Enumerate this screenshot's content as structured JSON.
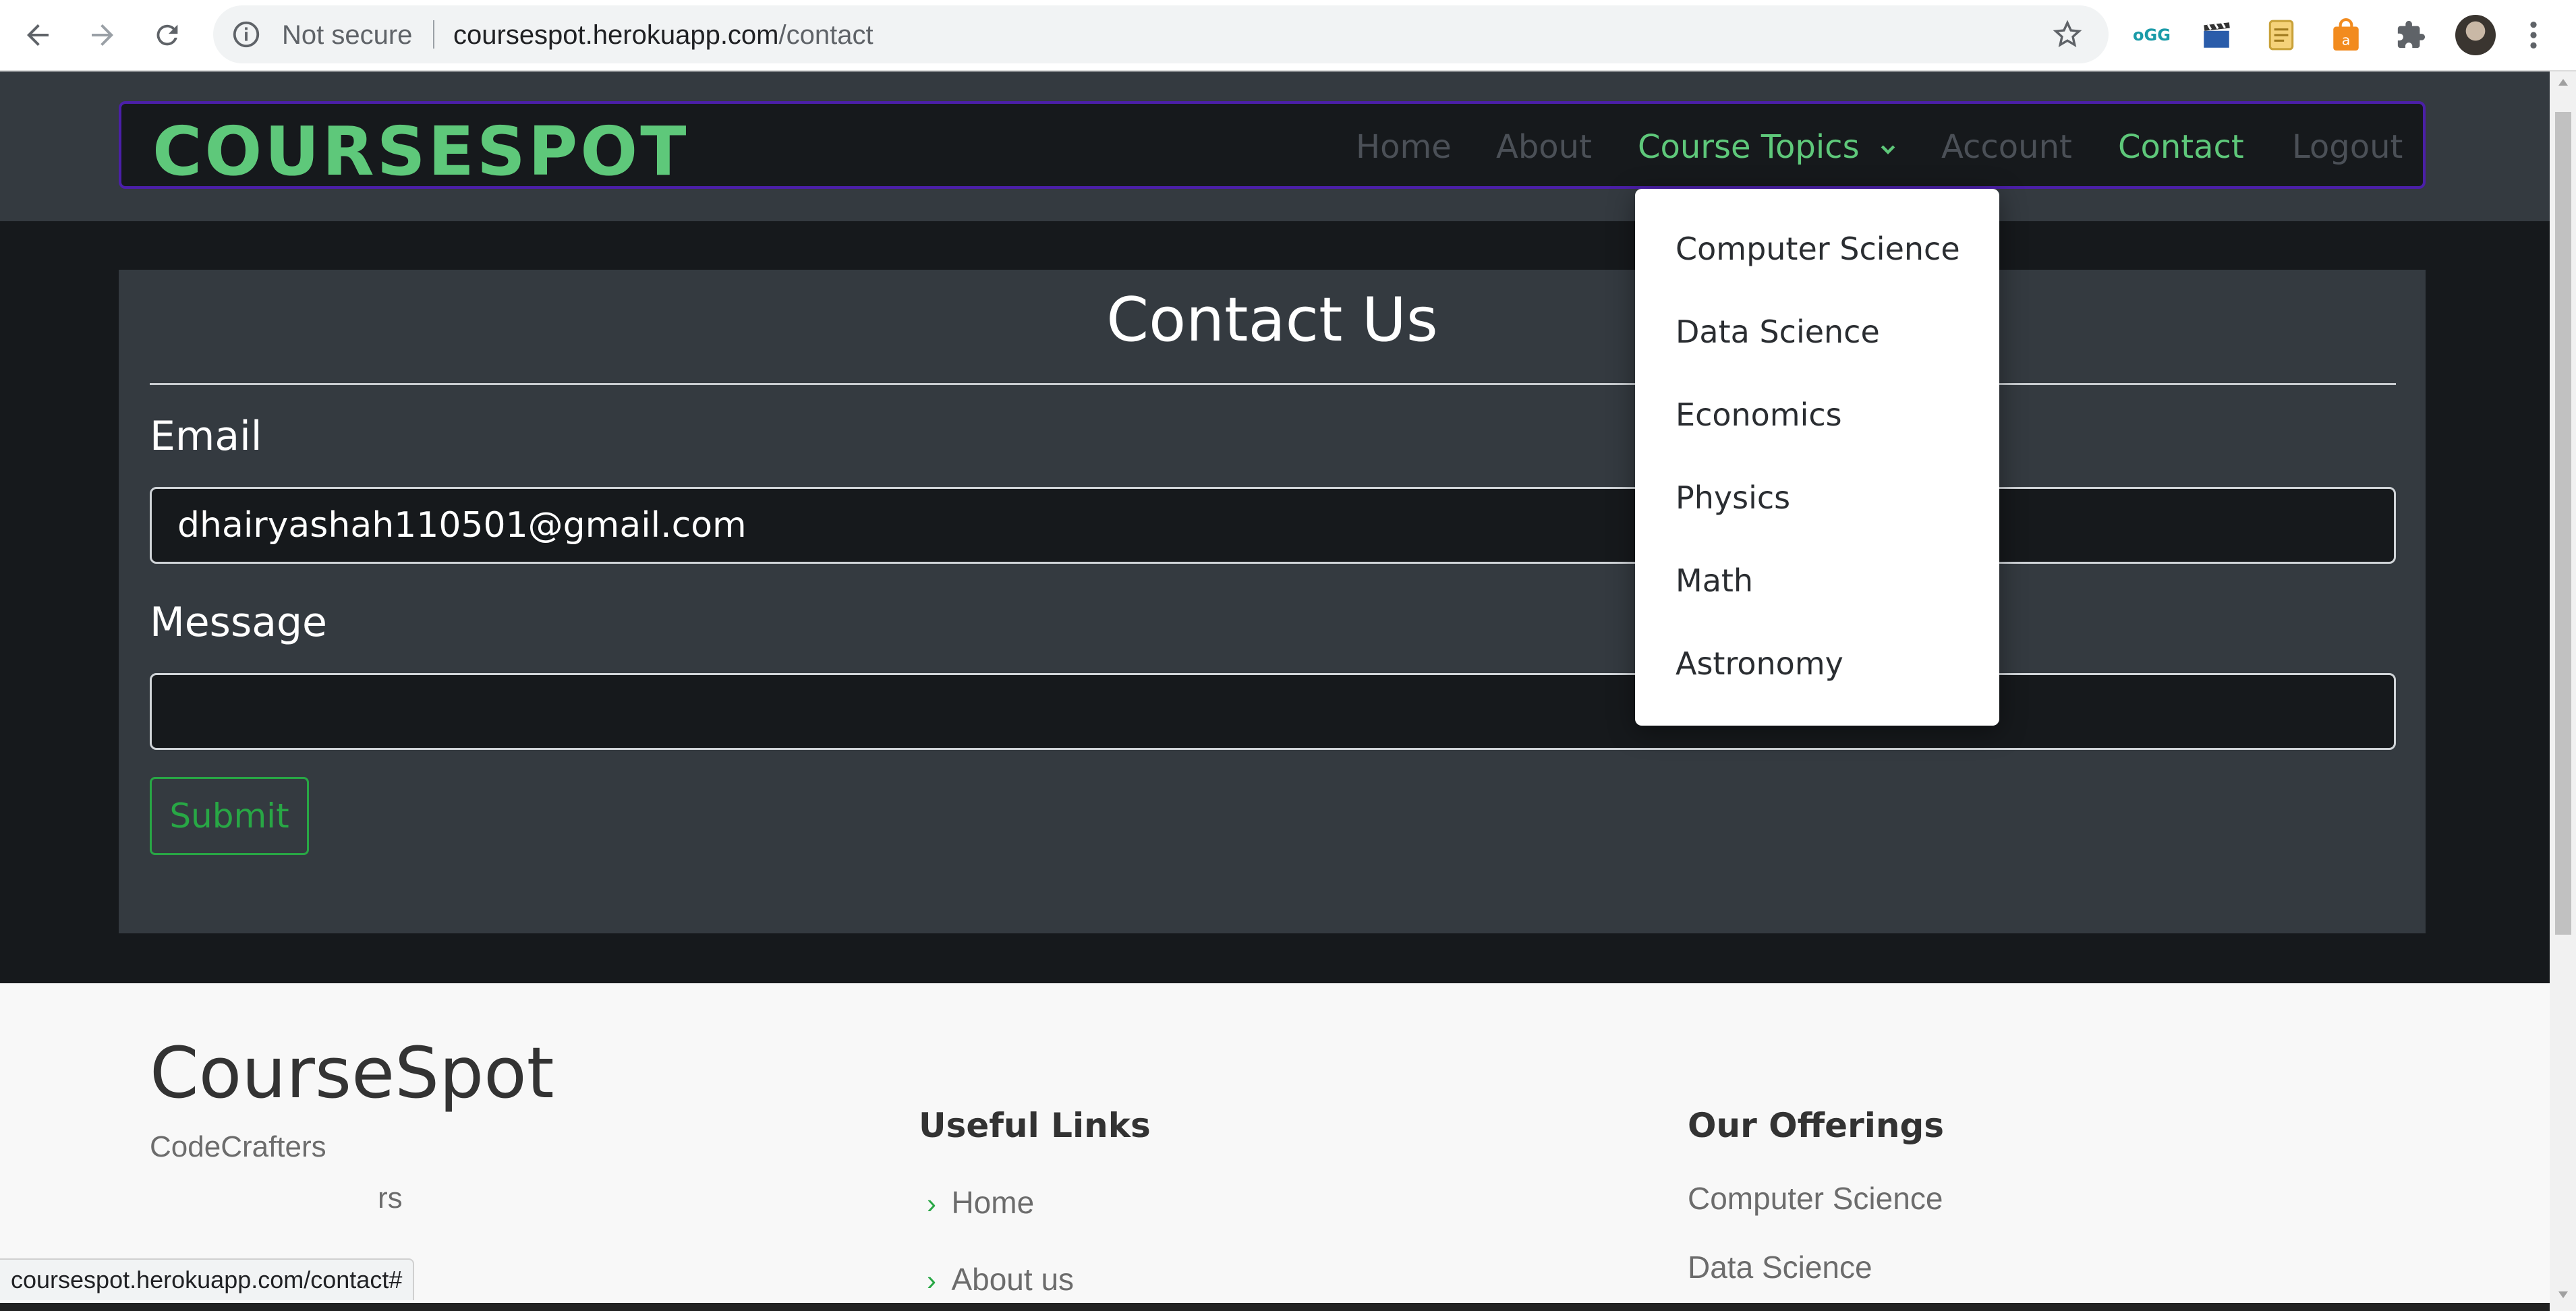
{
  "browser": {
    "security_label": "Not secure",
    "url_host": "coursespot.herokuapp.com",
    "url_path": "/contact",
    "status_url": "coursespot.herokuapp.com/contact#"
  },
  "navbar": {
    "brand": "COURSESPOT",
    "links": [
      {
        "label": "Home"
      },
      {
        "label": "About"
      },
      {
        "label": "Course Topics"
      },
      {
        "label": "Account"
      },
      {
        "label": "Contact"
      },
      {
        "label": "Logout"
      }
    ]
  },
  "dropdown": {
    "items": [
      "Computer Science",
      "Data Science",
      "Economics",
      "Physics",
      "Math",
      "Astronomy"
    ]
  },
  "contact": {
    "title": "Contact Us",
    "email_label": "Email",
    "email_value": "dhairyashah110501@gmail.com",
    "message_label": "Message",
    "message_value": "",
    "submit_label": "Submit"
  },
  "footer": {
    "brand": "CourseSpot",
    "tagline": "CodeCrafters",
    "tagline_visible_fragment": "rs",
    "useful_links": {
      "heading": "Useful Links",
      "items": [
        "Home",
        "About us"
      ]
    },
    "offerings": {
      "heading": "Our Offerings",
      "items": [
        "Computer Science",
        "Data Science"
      ]
    }
  },
  "colors": {
    "accent": "#5ec87a",
    "button": "#28a745",
    "navbar_border": "#4b1fa8",
    "card": "#343a40",
    "dark": "#16191c"
  }
}
